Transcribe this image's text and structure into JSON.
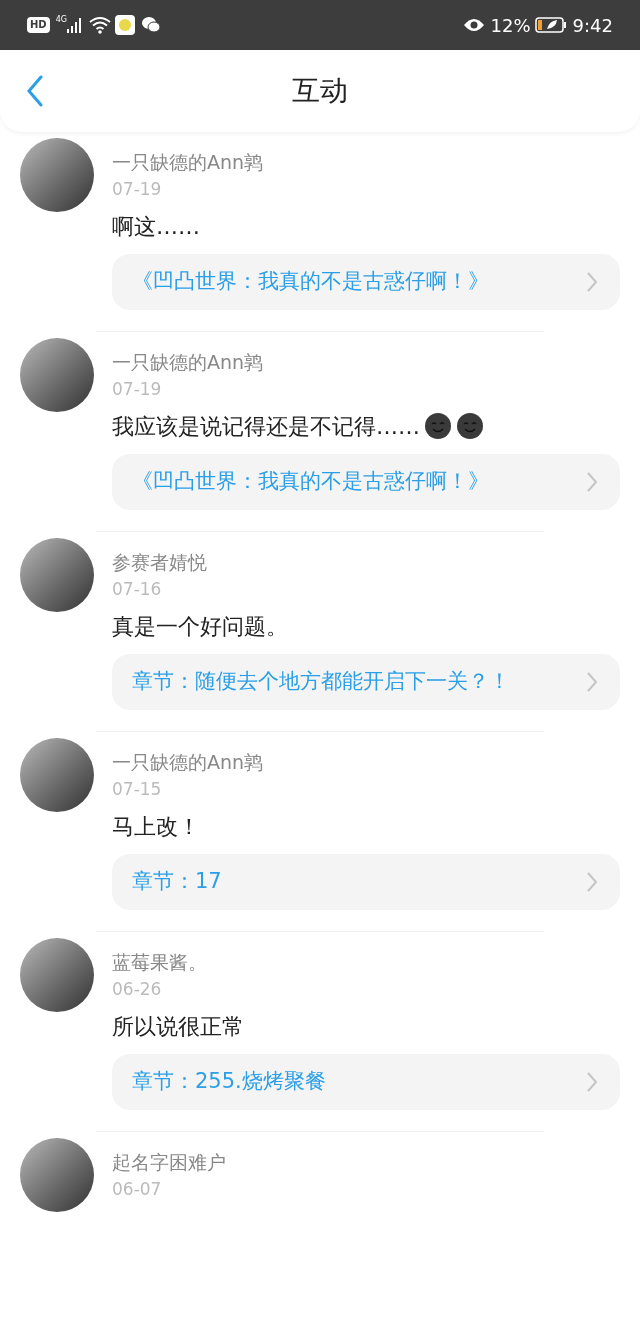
{
  "status_bar": {
    "hd": "HD",
    "network": "4G",
    "battery": "12%",
    "time": "9:42"
  },
  "header": {
    "title": "互动"
  },
  "items": [
    {
      "user": "一只缺德的Ann鹑",
      "date": "07-19",
      "comment": "啊这……",
      "link": "《凹凸世界：我真的不是古惑仔啊！》"
    },
    {
      "user": "一只缺德的Ann鹑",
      "date": "07-19",
      "comment": "我应该是说记得还是不记得……",
      "emojis": [
        {
          "kind": "dark-smiley"
        },
        {
          "kind": "dark-smiley"
        }
      ],
      "link": "《凹凸世界：我真的不是古惑仔啊！》"
    },
    {
      "user": "参赛者婧悦",
      "date": "07-16",
      "comment": "真是一个好问题。",
      "link": "章节：随便去个地方都能开启下一关？！"
    },
    {
      "user": "一只缺德的Ann鹑",
      "date": "07-15",
      "comment": "马上改！",
      "link": "章节：17"
    },
    {
      "user": "蓝莓果酱。",
      "date": "06-26",
      "comment": "所以说很正常",
      "link": "章节：255.烧烤聚餐"
    },
    {
      "user": "起名字困难户",
      "date": "06-07"
    }
  ]
}
